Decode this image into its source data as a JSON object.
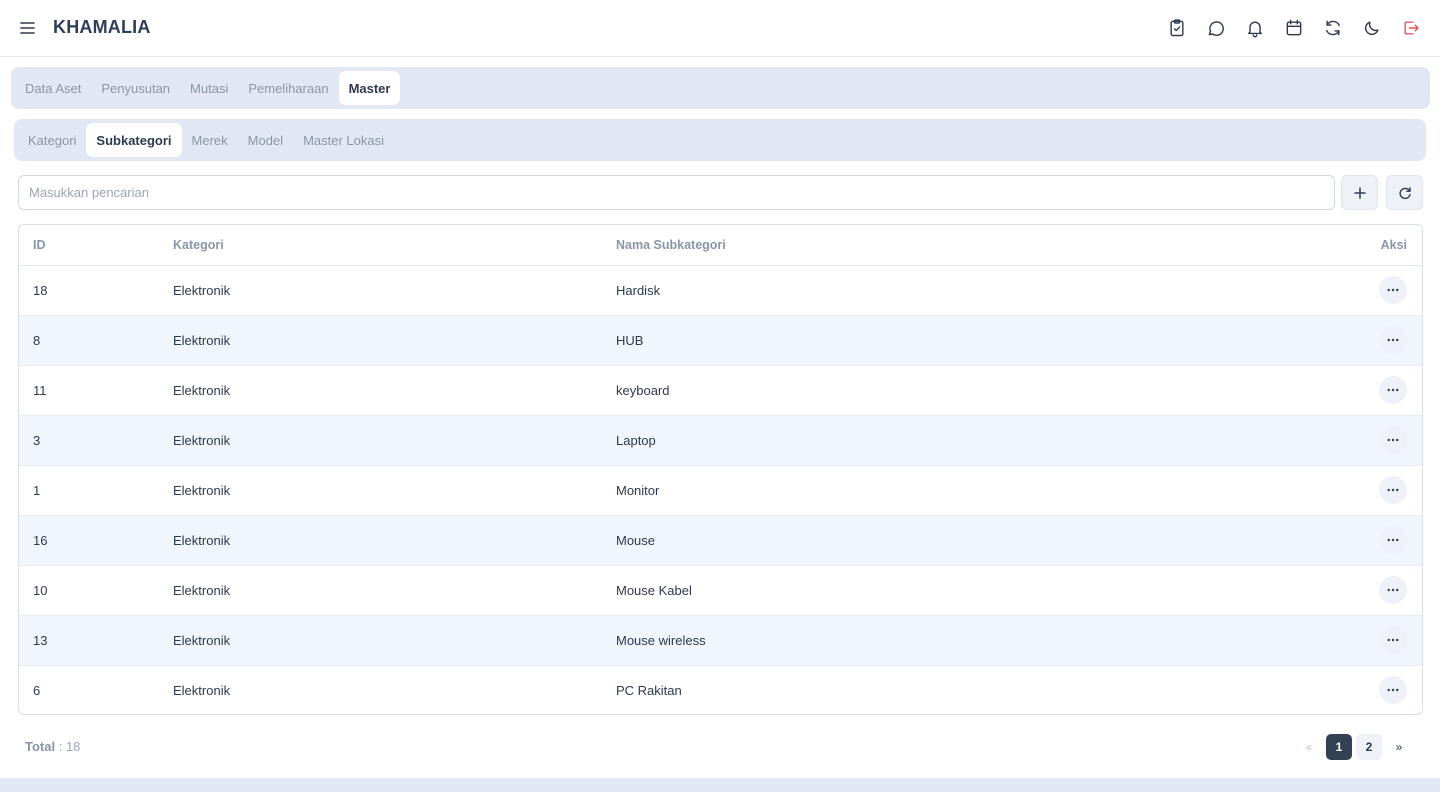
{
  "app": {
    "title": "KHAMALIA"
  },
  "top_icons": [
    "clipboard-check-icon",
    "chat-icon",
    "bell-icon",
    "calendar-icon",
    "refresh-icon",
    "moon-icon",
    "logout-icon"
  ],
  "tabs": [
    {
      "label": "Data Aset",
      "active": false
    },
    {
      "label": "Penyusutan",
      "active": false
    },
    {
      "label": "Mutasi",
      "active": false
    },
    {
      "label": "Pemeliharaan",
      "active": false
    },
    {
      "label": "Master",
      "active": true
    }
  ],
  "subtabs": [
    {
      "label": "Kategori",
      "active": false
    },
    {
      "label": "Subkategori",
      "active": true
    },
    {
      "label": "Merek",
      "active": false
    },
    {
      "label": "Model",
      "active": false
    },
    {
      "label": "Master Lokasi",
      "active": false
    }
  ],
  "search": {
    "placeholder": "Masukkan pencarian",
    "value": ""
  },
  "table": {
    "headers": {
      "id": "ID",
      "kategori": "Kategori",
      "nama": "Nama Subkategori",
      "aksi": "Aksi"
    },
    "rows": [
      {
        "id": "18",
        "kategori": "Elektronik",
        "nama": "Hardisk"
      },
      {
        "id": "8",
        "kategori": "Elektronik",
        "nama": "HUB"
      },
      {
        "id": "11",
        "kategori": "Elektronik",
        "nama": "keyboard"
      },
      {
        "id": "3",
        "kategori": "Elektronik",
        "nama": "Laptop"
      },
      {
        "id": "1",
        "kategori": "Elektronik",
        "nama": "Monitor"
      },
      {
        "id": "16",
        "kategori": "Elektronik",
        "nama": "Mouse"
      },
      {
        "id": "10",
        "kategori": "Elektronik",
        "nama": "Mouse Kabel"
      },
      {
        "id": "13",
        "kategori": "Elektronik",
        "nama": "Mouse wireless"
      },
      {
        "id": "6",
        "kategori": "Elektronik",
        "nama": "PC Rakitan"
      }
    ]
  },
  "footer": {
    "total_label": "Total",
    "total_value": ": 18",
    "pagination": {
      "prev": "«",
      "pages": [
        "1",
        "2"
      ],
      "current": "1",
      "next": "»"
    }
  },
  "colors": {
    "accent": "#334155",
    "tab_bg": "#e2e8f3",
    "logout": "#e05a5a"
  }
}
